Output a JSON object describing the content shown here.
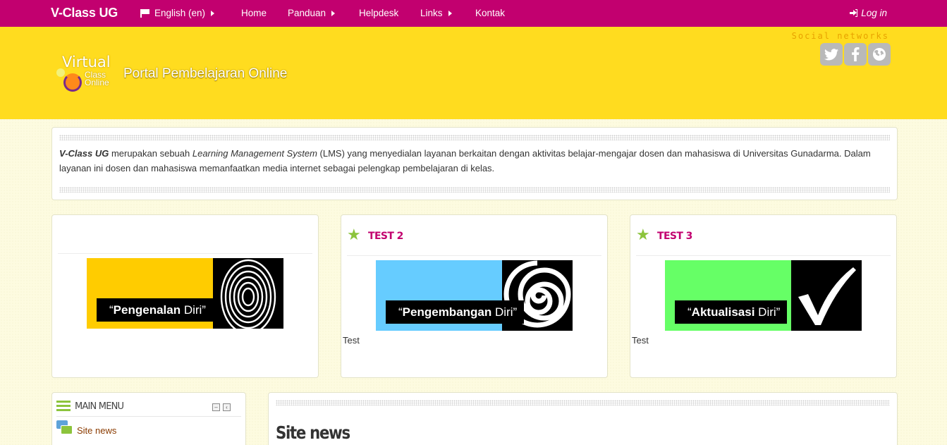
{
  "navbar": {
    "brand": "V-Class UG",
    "language": "English (en)",
    "items": [
      "Home",
      "Panduan",
      "Helpdesk",
      "Links",
      "Kontak"
    ],
    "login": "Log in"
  },
  "header": {
    "logo_virtual": "Virtual",
    "logo_class": "Class",
    "logo_online": "Online",
    "tagline": "Portal Pembelajaran Online",
    "social_label": "Social networks",
    "social_icons": [
      "twitter-icon",
      "facebook-icon",
      "globe-icon"
    ]
  },
  "intro": {
    "brand": "V-Class UG",
    "part1": " merupakan sebuah ",
    "lms": "Learning Management System",
    "part2": " (LMS) yang menyedialan layanan berkaitan dengan aktivitas belajar-mengajar dosen dan mahasiswa di Universitas Gunadarma. Dalam layanan ini dosen dan mahasiswa memanfaatkan media internet sebagai pelengkap pembelajaran di kelas."
  },
  "promos": [
    {
      "title": "",
      "banner_open": "“",
      "banner_bold": "Pengenalan",
      "banner_rest": " Diri”",
      "caption": ""
    },
    {
      "title": "TEST 2",
      "banner_open": "“",
      "banner_bold": "Pengembangan",
      "banner_rest": " Diri”",
      "caption": "Test"
    },
    {
      "title": "TEST 3",
      "banner_open": "“",
      "banner_bold": "Aktualisasi",
      "banner_rest": " Diri”",
      "caption": "Test"
    }
  ],
  "colors": {
    "navbar": "#c2006f",
    "header": "#ffdc1f",
    "banner1": "#ffcc00",
    "banner2": "#66ccff",
    "banner3": "#66ff66",
    "star": "#8cc43c"
  },
  "main_menu": {
    "title": "MAIN MENU",
    "items": [
      "Site news"
    ]
  },
  "news": {
    "title": "Site news"
  }
}
